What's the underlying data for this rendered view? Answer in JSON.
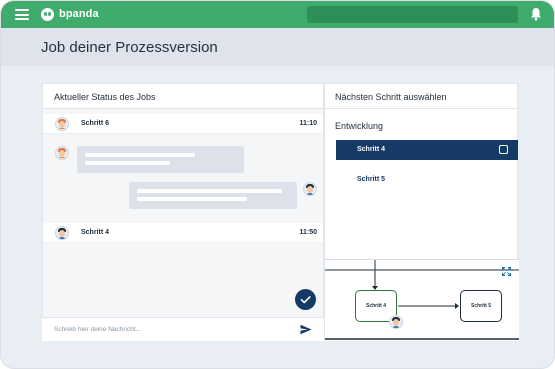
{
  "topbar": {
    "brand": "bpanda",
    "color": "#3fac6e",
    "menu_icon": "hamburger-icon",
    "bell_icon": "bell-icon"
  },
  "page": {
    "title": "Job deiner Prozessversion"
  },
  "left_panel": {
    "header": "Aktueller Status des Jobs",
    "jobs": [
      {
        "name": "Schritt 6",
        "time": "11:10"
      },
      {
        "name": "Schritt 4",
        "time": "11:50"
      }
    ],
    "input_placeholder": "Schreib hier deine Nachricht..."
  },
  "right_panel": {
    "header": "Nächsten Schritt auswählen",
    "environment": "Entwicklung",
    "options": [
      {
        "label": "Schritt 4",
        "selected": true
      },
      {
        "label": "Schritt 5",
        "selected": false
      }
    ],
    "diagram": {
      "nodes": [
        "Schritt 4",
        "Schritt 5"
      ]
    }
  },
  "colors": {
    "primary": "#153a66",
    "green": "#3fac6e",
    "active_node": "#2b7a3e"
  }
}
